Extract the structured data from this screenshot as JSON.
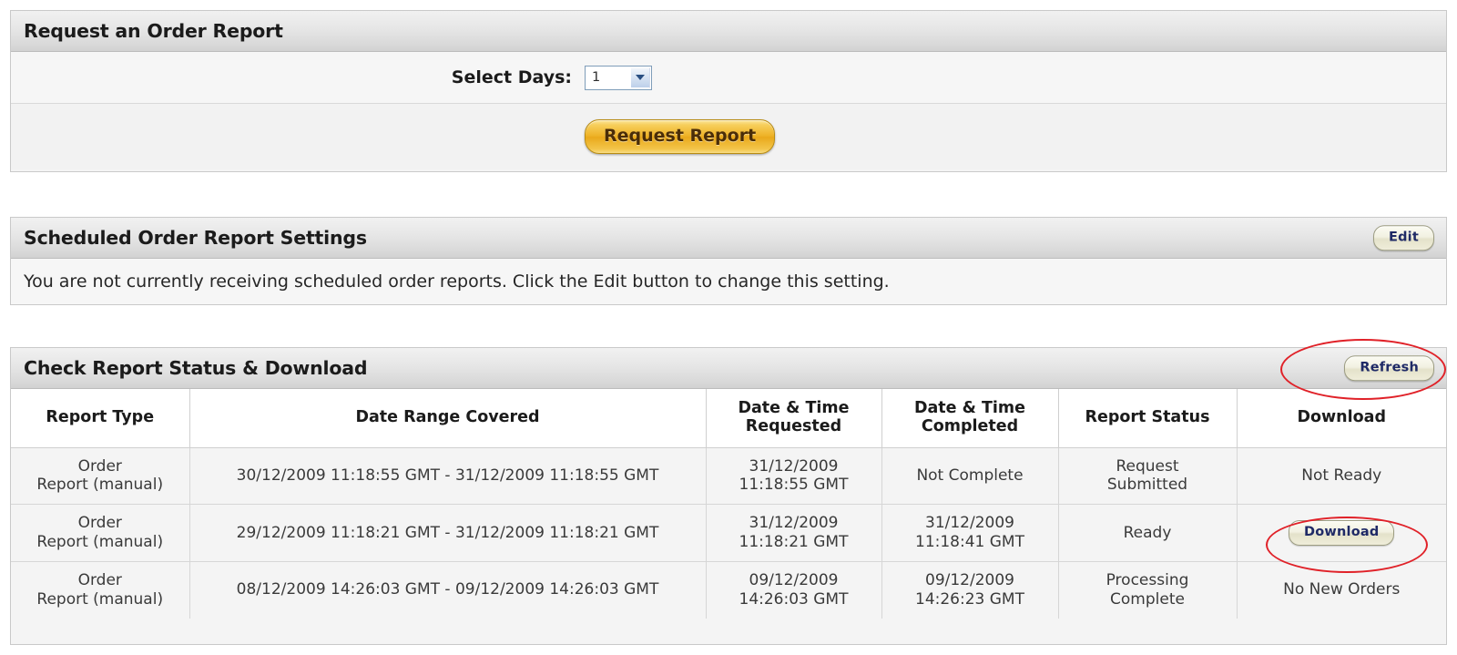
{
  "request_panel": {
    "title": "Request an Order Report",
    "select_label": "Select Days:",
    "select_value": "1",
    "select_options": [
      "1"
    ],
    "submit_label": "Request Report"
  },
  "scheduled_panel": {
    "title": "Scheduled Order Report Settings",
    "edit_label": "Edit",
    "notice": "You are not currently receiving scheduled order reports. Click the Edit button to change this setting."
  },
  "status_panel": {
    "title": "Check Report Status & Download",
    "refresh_label": "Refresh",
    "columns": [
      "Report Type",
      "Date Range Covered",
      "Date & Time\nRequested",
      "Date & Time\nCompleted",
      "Report Status",
      "Download"
    ],
    "columns_split": [
      {
        "line1": "Report Type",
        "line2": ""
      },
      {
        "line1": "Date Range Covered",
        "line2": ""
      },
      {
        "line1": "Date & Time",
        "line2": "Requested"
      },
      {
        "line1": "Date & Time",
        "line2": "Completed"
      },
      {
        "line1": "Report Status",
        "line2": ""
      },
      {
        "line1": "Download",
        "line2": ""
      }
    ],
    "rows": [
      {
        "type_line1": "Order",
        "type_line2": "Report (manual)",
        "date_range": "30/12/2009 11:18:55 GMT - 31/12/2009 11:18:55 GMT",
        "requested_line1": "31/12/2009",
        "requested_line2": "11:18:55 GMT",
        "completed_line1": "Not Complete",
        "completed_line2": "",
        "status_line1": "Request",
        "status_line2": "Submitted",
        "download_text": "Not Ready",
        "download_is_button": false
      },
      {
        "type_line1": "Order",
        "type_line2": "Report (manual)",
        "date_range": "29/12/2009 11:18:21 GMT - 31/12/2009 11:18:21 GMT",
        "requested_line1": "31/12/2009",
        "requested_line2": "11:18:21 GMT",
        "completed_line1": "31/12/2009",
        "completed_line2": "11:18:41 GMT",
        "status_line1": "Ready",
        "status_line2": "",
        "download_text": "Download",
        "download_is_button": true
      },
      {
        "type_line1": "Order",
        "type_line2": "Report (manual)",
        "date_range": "08/12/2009 14:26:03 GMT - 09/12/2009 14:26:03 GMT",
        "requested_line1": "09/12/2009",
        "requested_line2": "14:26:03 GMT",
        "completed_line1": "09/12/2009",
        "completed_line2": "14:26:23 GMT",
        "status_line1": "Processing",
        "status_line2": "Complete",
        "download_text": "No New Orders",
        "download_is_button": false
      }
    ]
  },
  "annotations": {
    "color": "#e02128",
    "shapes": [
      {
        "name": "refresh-highlight",
        "target": "Refresh"
      },
      {
        "name": "download-highlight",
        "target": "Download"
      }
    ]
  }
}
